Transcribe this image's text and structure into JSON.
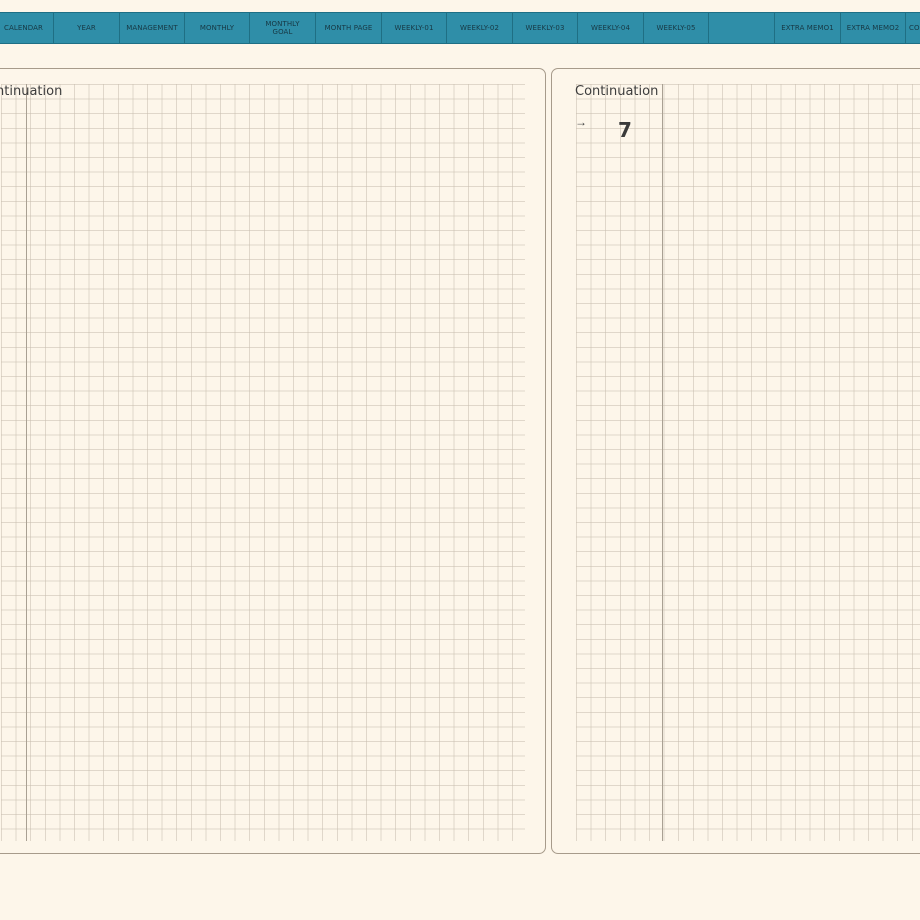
{
  "tabs": [
    {
      "label": "CALENDAR"
    },
    {
      "label": "YEAR"
    },
    {
      "label": "MANAGEMENT"
    },
    {
      "label": "MONTHLY"
    },
    {
      "label": "MONTHLY\nGOAL"
    },
    {
      "label": "MONTH PAGE"
    },
    {
      "label": "WEEKLY-01"
    },
    {
      "label": "WEEKLY-02"
    },
    {
      "label": "WEEKLY-03"
    },
    {
      "label": "WEEKLY-04"
    },
    {
      "label": "WEEKLY-05"
    },
    {
      "label": ""
    },
    {
      "label": "EXTRA MEMO1"
    },
    {
      "label": "EXTRA MEMO2"
    },
    {
      "label": "CO"
    }
  ],
  "left_page": {
    "label": "Continuation"
  },
  "right_page": {
    "label": "Continuation",
    "arrow": "→",
    "number": "7"
  },
  "colors": {
    "tab_bar": "#2f8ea8",
    "page_bg": "#fdf6ea",
    "page_border": "#a79b8b"
  }
}
